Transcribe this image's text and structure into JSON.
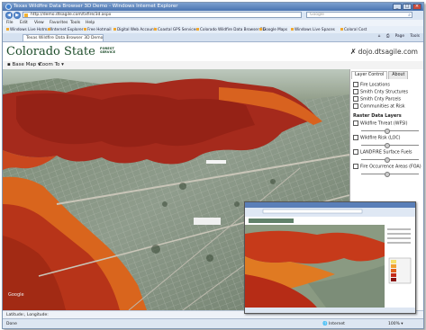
{
  "browser": {
    "window_title": "Texas Wildfire Data Browser 3D Demo - Windows Internet Explorer",
    "address": "http://demo.dtsagile.com/txfire/3d.aspx",
    "search_placeholder": "Google",
    "menu": [
      "File",
      "Edit",
      "View",
      "Favorites",
      "Tools",
      "Help"
    ],
    "favorites": [
      "Windows Live Hotmail",
      "Internet Explorer",
      "Free Hotmail",
      "Digital Web Account",
      "Coastal GPS Services",
      "Colorado Wildfire Data Browser 3D",
      "Google Maps",
      "Windows Live Spaces",
      "Coloral Cost"
    ],
    "tab_title": "Texas Wildfire Data Browser 3D Demo",
    "tools": [
      "Page",
      "Tools"
    ],
    "status_done": "Done",
    "zone": "Internet",
    "zoom": "100%"
  },
  "header": {
    "logo": "Colorado State",
    "logo_sub": "FOREST SERVICE",
    "dojo": "dojo.dtsagile.com"
  },
  "app_toolbar": {
    "base_map": "Base Map",
    "zoom_to": "Zoom To"
  },
  "panel": {
    "tabs": [
      "Layer Control",
      "About"
    ],
    "vector_layers": [
      "Fire Locations",
      "Smith Cnty Structures",
      "Smith Cnty Parcels",
      "Communities at Risk"
    ],
    "raster_title": "Raster Data Layers",
    "raster_layers": [
      "Wildfire Threat (WFSI)",
      "Wildfire Risk (LOC)",
      "LANDFIRE Surface Fuels",
      "Fire Occurrence Areas (FOA)"
    ]
  },
  "map": {
    "coords_label": "Latitude:, Longitude:",
    "corner_logo": "Google"
  },
  "colors": {
    "forest_green": "#1e4d2b",
    "titlebar": "#4a74b0",
    "fire_red": "#b22818",
    "fire_orange": "#e06a1e"
  }
}
